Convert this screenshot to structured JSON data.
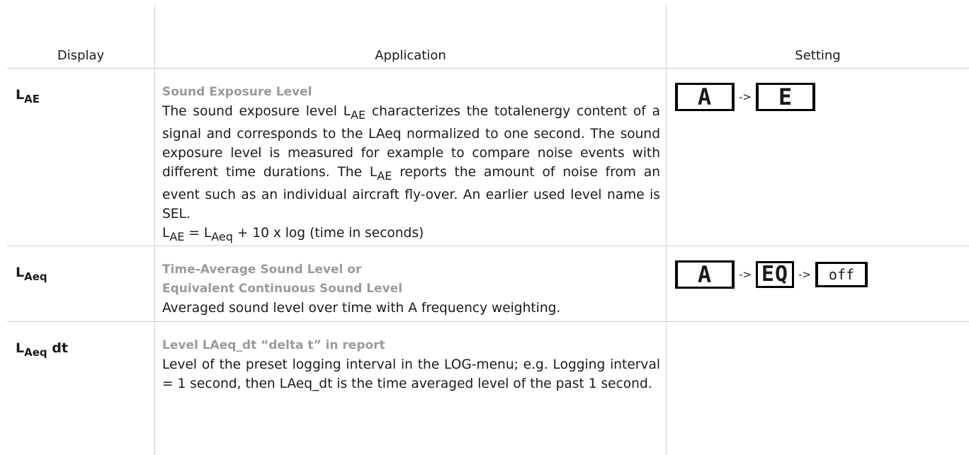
{
  "header": {
    "display": "Display",
    "application": "Application",
    "setting": "Setting"
  },
  "rows": [
    {
      "display_main": "L",
      "display_sub": "AE",
      "display_suffix": "",
      "title": "Sound Exposure Level",
      "body_parts": [
        "The sound exposure level L",
        "AE",
        " characterizes the totalenergy content of a signal and corresponds to the LAeq normalized to one second. The sound exposure level is measured for example to compare noise events with different time durations. The L",
        "AE",
        " reports the amount of noise from an event such as an individual aircraft fly-over. An earlier used level name is SEL."
      ],
      "formula_parts": [
        "L",
        "AE",
        " = L",
        "Aeq",
        " + 10 x log (time in seconds)"
      ],
      "setting": [
        {
          "type": "lcd",
          "text": "A"
        },
        {
          "type": "arrow",
          "text": "->"
        },
        {
          "type": "lcd",
          "text": "E"
        }
      ]
    },
    {
      "display_main": "L",
      "display_sub": "Aeq",
      "display_suffix": "",
      "title_line1": "Time-Average Sound Level or",
      "title_line2": "Equivalent Continuous Sound Level",
      "body": "Averaged sound level over time with A frequency weighting.",
      "setting": [
        {
          "type": "lcd",
          "text": "A"
        },
        {
          "type": "arrow",
          "text": "->"
        },
        {
          "type": "lcd",
          "text": "EQ"
        },
        {
          "type": "arrow",
          "text": "->"
        },
        {
          "type": "lcd",
          "text": "off"
        }
      ]
    },
    {
      "display_main": "L",
      "display_sub": "Aeq",
      "display_suffix": " dt",
      "title": "Level LAeq_dt “delta t” in report",
      "body": "Level of the preset logging interval in the LOG-menu; e.g. Logging interval = 1 second, then LAeq_dt is the time averaged level of the past 1 second."
    }
  ]
}
